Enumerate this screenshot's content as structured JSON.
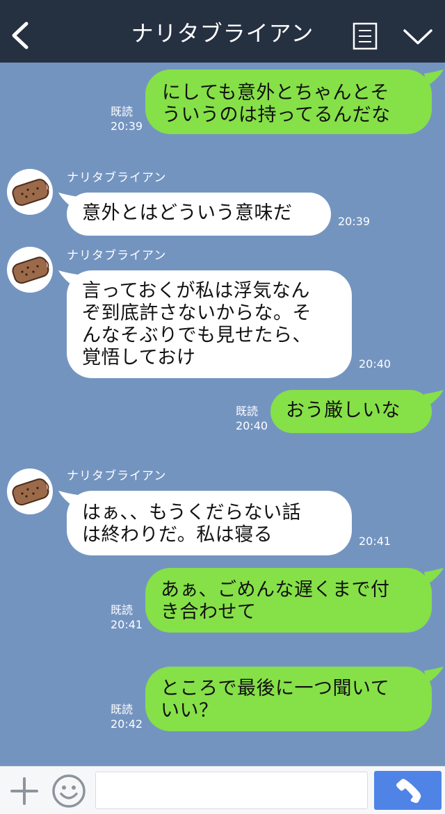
{
  "header": {
    "title": "ナリタブライアン",
    "back_icon": "chevron-left-icon",
    "menu_icon": "list-icon",
    "dropdown_icon": "chevron-down-icon"
  },
  "colors": {
    "header_bg": "#253041",
    "chat_bg": "#7494c0",
    "sent_bubble": "#86e048",
    "recv_bubble": "#ffffff",
    "call_button": "#4f84e6"
  },
  "messages": [
    {
      "type": "sent",
      "text": "にしても意外とちゃんとそ\nういうのは持ってるんだな",
      "read": "既読",
      "time": "20:39"
    },
    {
      "type": "recv",
      "sender": "ナリタブライアン",
      "text": "意外とはどういう意味だ",
      "time": "20:39"
    },
    {
      "type": "recv",
      "sender": "ナリタブライアン",
      "text": "言っておくが私は浮気なん\nぞ到底許さないからな。そ\nんなそぶりでも見せたら、\n覚悟しておけ",
      "time": "20:40"
    },
    {
      "type": "sent",
      "text": "おう厳しいな",
      "read": "既読",
      "time": "20:40"
    },
    {
      "type": "recv",
      "sender": "ナリタブライアン",
      "text": "はぁ、、もうくだらない話\nは終わりだ。私は寝る",
      "time": "20:41"
    },
    {
      "type": "sent",
      "text": "あぁ、ごめんな遅くまで付\nき合わせて",
      "read": "既読",
      "time": "20:41"
    },
    {
      "type": "sent",
      "text": "ところで最後に一つ聞いて\nいい？",
      "read": "既読",
      "time": "20:42"
    }
  ],
  "bottom_bar": {
    "plus_icon": "plus-icon",
    "emoji_icon": "smile-icon",
    "input_value": "",
    "call_icon": "phone-icon"
  }
}
